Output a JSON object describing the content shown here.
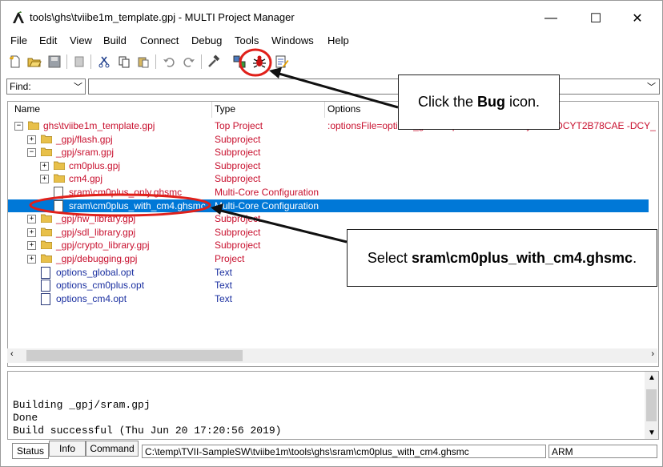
{
  "window": {
    "title": "tools\\ghs\\tviibe1m_template.gpj - MULTI Project Manager",
    "minimize": "—",
    "maximize": "☐",
    "close": "✕"
  },
  "menu": [
    "File",
    "Edit",
    "View",
    "Build",
    "Connect",
    "Debug",
    "Tools",
    "Windows",
    "Help"
  ],
  "find": {
    "label": "Find:",
    "value": ""
  },
  "columns": {
    "name": "Name",
    "type": "Type",
    "options": "Options"
  },
  "tree": [
    {
      "label": "ghs\\tviibe1m_template.gpj",
      "type": "Top Project",
      "options": ":optionsFile=options_global.opt -Dtviibe1m -Dcyt2b7 -DCYT2B78CAE -DCY_",
      "color": "#c8102e",
      "expander": "−",
      "icon": "folder-icon"
    },
    {
      "label": "_gpj/flash.gpj",
      "type": "Subproject",
      "options": "",
      "color": "#c8102e",
      "expander": "+",
      "icon": "folder-icon"
    },
    {
      "label": "_gpj/sram.gpj",
      "type": "Subproject",
      "options": "",
      "color": "#c8102e",
      "expander": "−",
      "icon": "folder-icon"
    },
    {
      "label": "cm0plus.gpj",
      "type": "Subproject",
      "options": "",
      "color": "#c8102e",
      "expander": "+",
      "icon": "folder-icon"
    },
    {
      "label": "cm4.gpj",
      "type": "Subproject",
      "options": "",
      "color": "#c8102e",
      "expander": "+",
      "icon": "folder-icon"
    },
    {
      "label": "sram\\cm0plus_only.ghsmc",
      "type": "Multi-Core Configuration",
      "options": "",
      "color": "#c8102e",
      "expander": "",
      "icon": "file-icon"
    },
    {
      "label": "sram\\cm0plus_with_cm4.ghsmc",
      "type": "Multi-Core Configuration",
      "options": "",
      "color": "#c8102e",
      "expander": "",
      "icon": "file-icon",
      "selected": true
    },
    {
      "label": "_gpj/hw_library.gpj",
      "type": "Subproject",
      "options": "",
      "color": "#c8102e",
      "expander": "+",
      "icon": "folder-icon"
    },
    {
      "label": "_gpj/sdl_library.gpj",
      "type": "Subproject",
      "options": "",
      "color": "#c8102e",
      "expander": "+",
      "icon": "folder-icon"
    },
    {
      "label": "_gpj/crypto_library.gpj",
      "type": "Subproject",
      "options": "",
      "color": "#c8102e",
      "expander": "+",
      "icon": "folder-icon"
    },
    {
      "label": "_gpj/debugging.gpj",
      "type": "Project",
      "options": "",
      "color": "#c8102e",
      "expander": "+",
      "icon": "folder-icon"
    },
    {
      "label": "options_global.opt",
      "type": "Text",
      "options": "",
      "color": "#1a2fa0",
      "expander": "",
      "icon": "text-file-icon"
    },
    {
      "label": "options_cm0plus.opt",
      "type": "Text",
      "options": "",
      "color": "#1a2fa0",
      "expander": "",
      "icon": "text-file-icon"
    },
    {
      "label": "options_cm4.opt",
      "type": "Text",
      "options": "",
      "color": "#1a2fa0",
      "expander": "",
      "icon": "text-file-icon"
    }
  ],
  "output": [
    "Building _gpj/sram.gpj",
    "Done",
    "Build successful (Thu Jun 20 17:20:56 2019)"
  ],
  "tabs": [
    "Status",
    "Info",
    "Command"
  ],
  "status": {
    "path": "C:\\temp\\TVII-SampleSW\\tviibe1m\\tools\\ghs\\sram\\cm0plus_with_cm4.ghsmc",
    "arch": "ARM"
  },
  "annotations": {
    "callout1": {
      "pre": "Click the ",
      "bold": "Bug",
      "post": " icon."
    },
    "callout2": {
      "pre": "Select ",
      "bold": "sram\\cm0plus_with_cm4.ghsmc",
      "post": "."
    },
    "highlight_color": "#e0201a"
  }
}
